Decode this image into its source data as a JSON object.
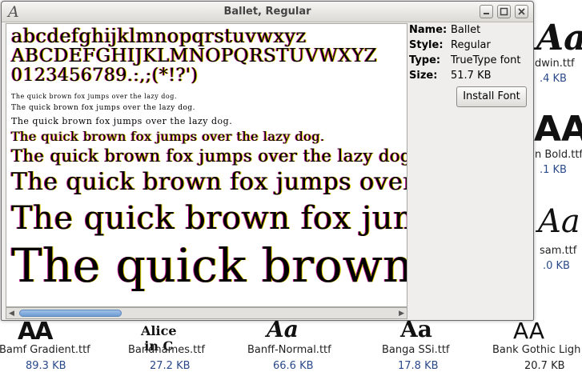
{
  "window": {
    "title": "Ballet, Regular",
    "app_icon": "A"
  },
  "preview": {
    "lowercase": "abcdefghijklmnopqrstuvwxyz",
    "uppercase": "ABCDEFGHIJKLMNOPQRSTUVWXYZ",
    "digits": "0123456789.:,;(*!?')",
    "sample": "The quick brown fox jumps over the lazy dog."
  },
  "info": {
    "name_label": "Name:",
    "name_value": "Ballet",
    "style_label": "Style:",
    "style_value": "Regular",
    "type_label": "Type:",
    "type_value": "TrueType font",
    "size_label": "Size:",
    "size_value": "51.7 KB",
    "install_button": "Install Font"
  },
  "background_files": {
    "right_column": [
      {
        "thumb": "Aa",
        "name": "dwin.ttf",
        "size": ".4 KB"
      },
      {
        "thumb": "AA",
        "name": "n Bold.ttf",
        "size": ".1 KB"
      },
      {
        "thumb": "Aa",
        "name": "sam.ttf",
        "size": ".0 KB"
      }
    ],
    "bottom_row": [
      {
        "thumb": "AA",
        "name": "Bamf Gradient.ttf",
        "size": "89.3 KB"
      },
      {
        "thumb": "Alice in C",
        "name": "Bandnames.ttf",
        "size": "27.2 KB"
      },
      {
        "thumb": "Aa",
        "name": "Banff-Normal.ttf",
        "size": "66.6 KB"
      },
      {
        "thumb": "Aa",
        "name": "Banga SSi.ttf",
        "size": "17.8 KB"
      },
      {
        "thumb": "AA",
        "name": "Bank Gothic Ligh BT.ttf",
        "size": "20.7 KB"
      }
    ]
  }
}
